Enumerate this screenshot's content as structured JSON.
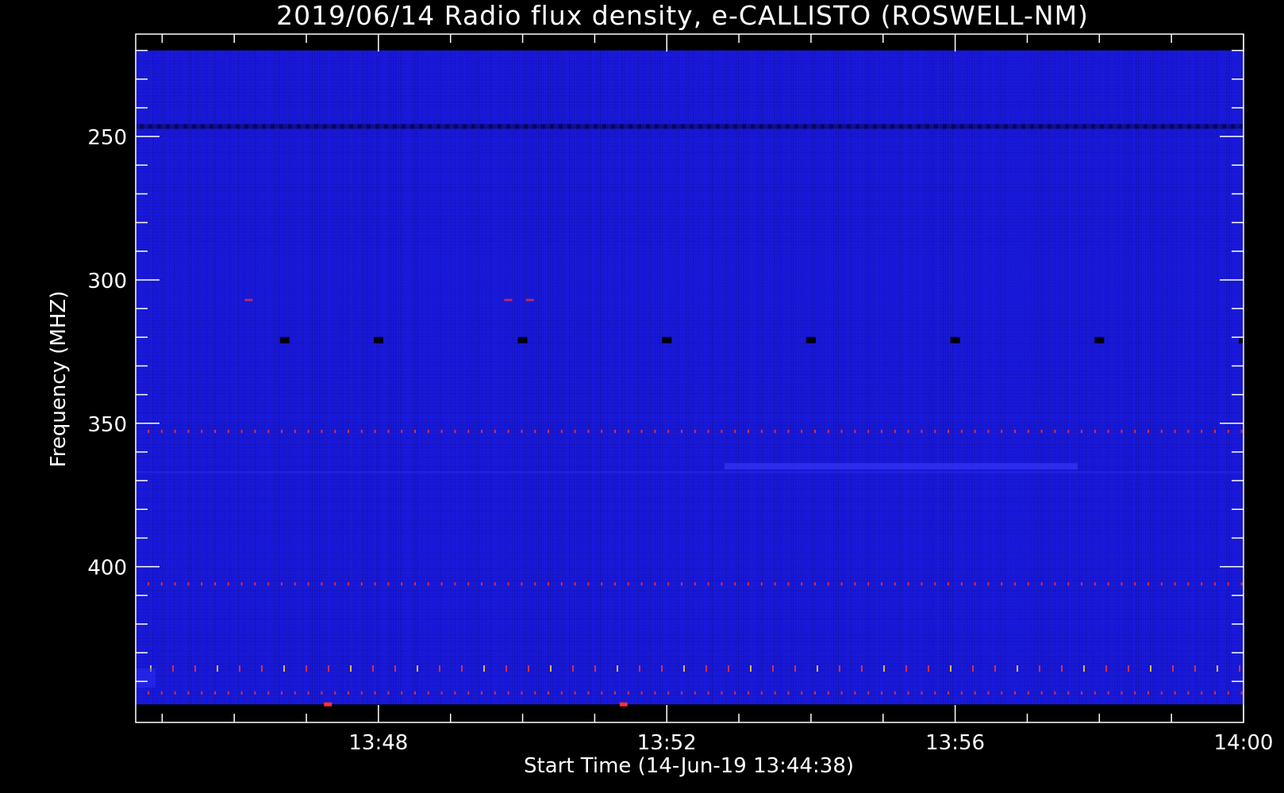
{
  "chart_data": {
    "type": "heatmap",
    "title": "2019/06/14  Radio flux density, e-CALLISTO (ROSWELL-NM)",
    "xlabel": "Start Time (14-Jun-19 13:44:38)",
    "ylabel": "Frequency (MHZ)",
    "x_axis": {
      "range_minutes_of_day": [
        824.633,
        840
      ],
      "data_extent_minutes_of_day": [
        824.633,
        840
      ],
      "tick_labels": [
        "13:48",
        "13:52",
        "13:56",
        "14:00"
      ],
      "tick_values_minutes_of_day": [
        828,
        832,
        836,
        840
      ],
      "minor_tick_values_minutes_of_day": [
        825,
        826,
        827,
        829,
        830,
        831,
        833,
        834,
        835,
        837,
        838,
        839
      ]
    },
    "y_axis": {
      "range_mhz": [
        214.3,
        454.3
      ],
      "inverted": true,
      "data_extent_mhz": [
        220,
        448
      ],
      "tick_labels": [
        "250",
        "300",
        "350",
        "400"
      ],
      "tick_values_mhz": [
        250,
        300,
        350,
        400
      ],
      "minor_tick_values_mhz": [
        220,
        230,
        240,
        260,
        270,
        280,
        290,
        310,
        320,
        330,
        340,
        360,
        370,
        380,
        390,
        410,
        420,
        430,
        440
      ]
    },
    "colormap": {
      "background": "#1a1ae0",
      "low": "#0a0a6e",
      "high": "#ff3030",
      "peak": "#ffd040"
    },
    "features": [
      {
        "kind": "dark_band",
        "freq_mhz": 246.5
      },
      {
        "kind": "dark_dots",
        "freq_mhz": 321,
        "times_minutes_of_day": [
          826.7,
          828,
          830,
          832,
          834,
          836,
          838,
          840
        ]
      },
      {
        "kind": "faint_red_dots",
        "freq_mhz": 307,
        "times_minutes_of_day": [
          826.2,
          829.8,
          830.1
        ]
      },
      {
        "kind": "red_tick_row",
        "freq_mhz": 352.8
      },
      {
        "kind": "red_tick_row",
        "freq_mhz": 406
      },
      {
        "kind": "red_tick_row",
        "freq_mhz": 444
      },
      {
        "kind": "bright_blue_streak",
        "freq_mhz": 365,
        "time_range_minutes_of_day": [
          832.8,
          837.7
        ]
      },
      {
        "kind": "mixed_row",
        "freq_mhz": 435.5
      },
      {
        "kind": "bright_red_dot",
        "freq_mhz": 448,
        "times_minutes_of_day": [
          827.3,
          831.4
        ]
      }
    ],
    "grid": false
  }
}
